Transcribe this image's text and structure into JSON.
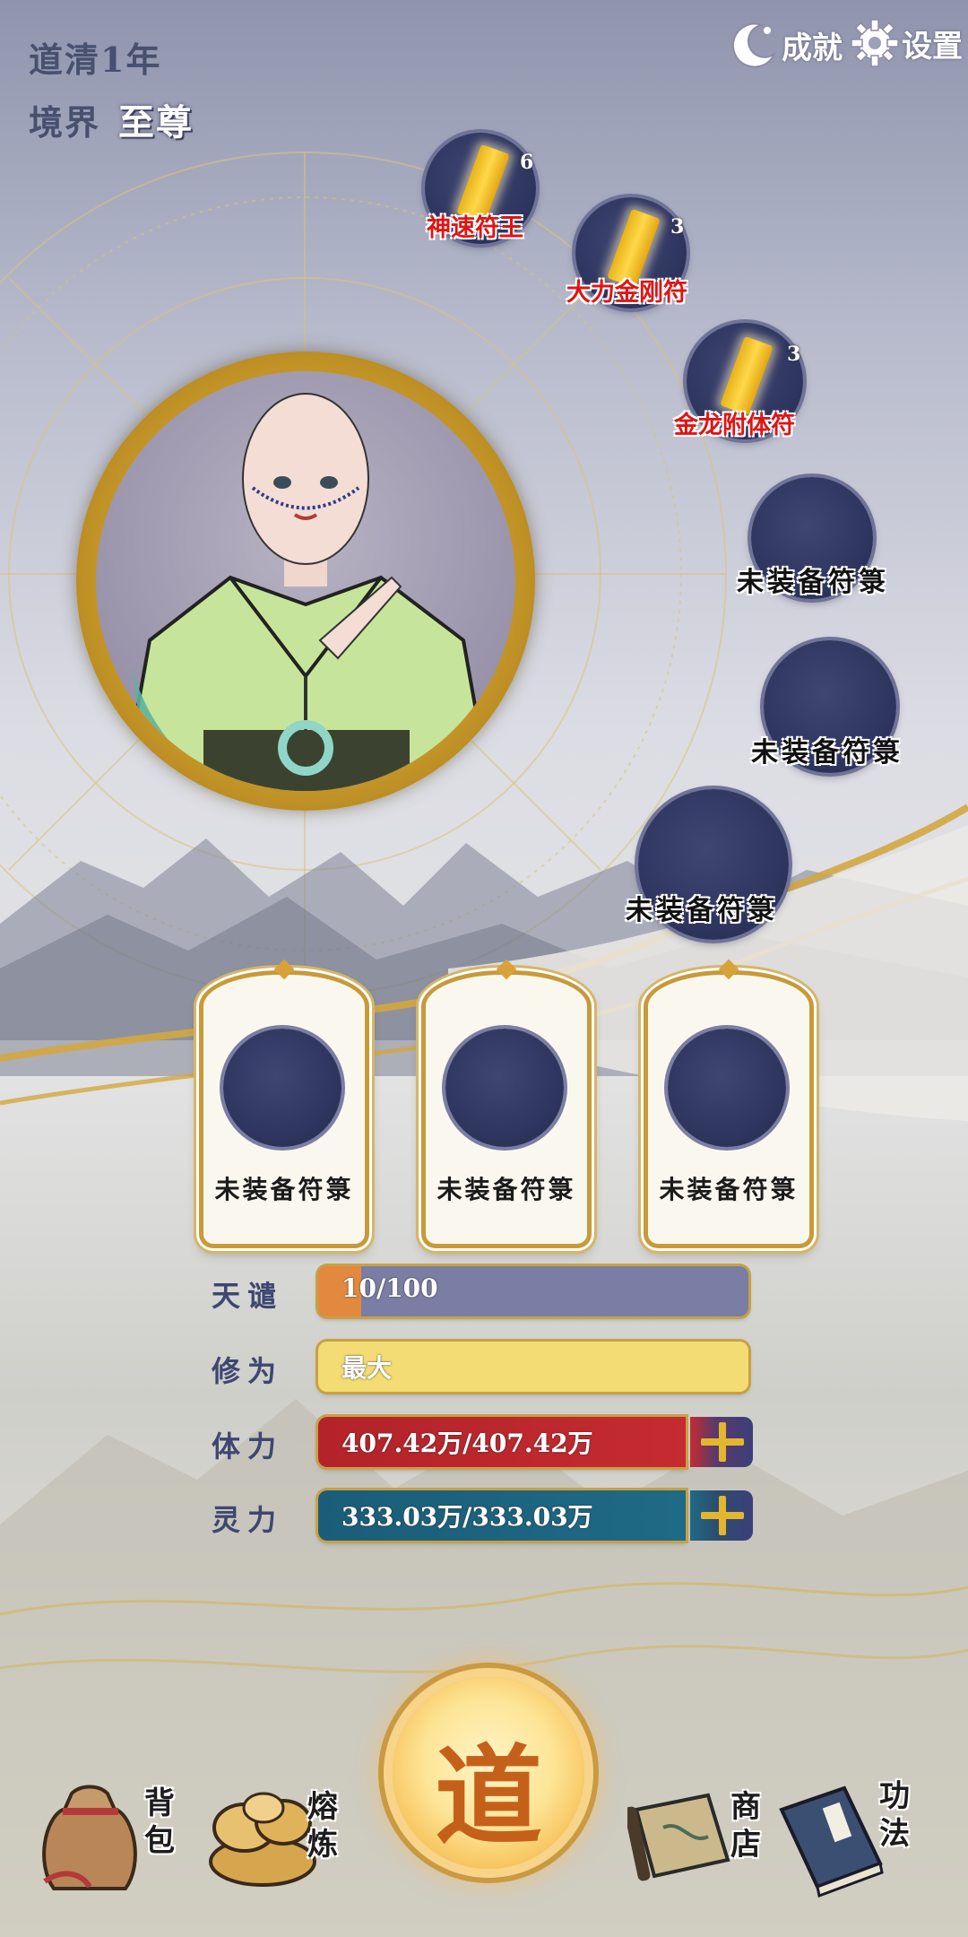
{
  "header": {
    "dao_label": "道清",
    "dao_years": "1年",
    "realm_label": "境界",
    "realm_value": "至尊"
  },
  "top_buttons": {
    "achievements": "成就",
    "settings": "设置"
  },
  "equipped_talismans": [
    {
      "name": "神速符王",
      "count": "6"
    },
    {
      "name": "大力金刚符",
      "count": "3"
    },
    {
      "name": "金龙附体符",
      "count": "3"
    }
  ],
  "empty_slots": {
    "label": "未装备符箓"
  },
  "cards": [
    {
      "label": "未装备符箓"
    },
    {
      "label": "未装备符箓"
    },
    {
      "label": "未装备符箓"
    }
  ],
  "stats": {
    "tianqian": {
      "label": "天谴",
      "value": "10/100",
      "progress": 0.1
    },
    "xiuwei": {
      "label": "修为",
      "value": "最大"
    },
    "tili": {
      "label": "体力",
      "value": "407.42万/407.42万"
    },
    "lingli": {
      "label": "灵力",
      "value": "333.03万/333.03万"
    }
  },
  "bottom_nav": {
    "bag": "背包",
    "smelt": "熔炼",
    "dao": "道",
    "shop": "商店",
    "skills": "功法"
  },
  "colors": {
    "tianqian_bar": "#7a7ea4",
    "tianqian_fill": "#e2893f",
    "xiuwei_bar": "#f2dc73",
    "tili_bar": "#b3232a",
    "lingli_bar": "#1b5d78",
    "accent_gold": "#c9a045"
  }
}
